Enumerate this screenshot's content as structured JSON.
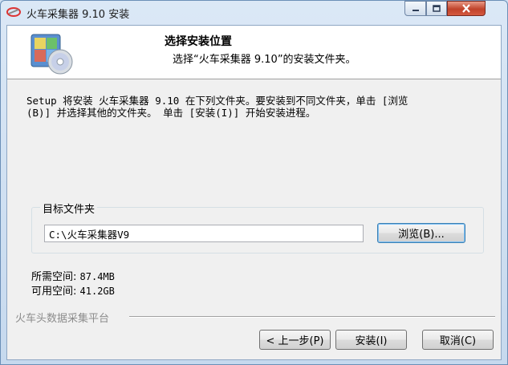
{
  "window": {
    "title": "火车采集器 9.10 安装"
  },
  "header": {
    "title": "选择安装位置",
    "subtitle": "选择“火车采集器 9.10”的安装文件夹。"
  },
  "description": {
    "line1": "Setup 将安装 火车采集器 9.10 在下列文件夹。要安装到不同文件夹，单击 [浏览",
    "line2": "(B)] 并选择其他的文件夹。 单击 [安装(I)] 开始安装进程。"
  },
  "destination": {
    "group_label": "目标文件夹",
    "path": "C:\\火车采集器V9",
    "browse_label": "浏览(B)..."
  },
  "space": {
    "required_label": "所需空间:",
    "required_value": "87.4MB",
    "available_label": "可用空间:",
    "available_value": "41.2GB"
  },
  "footer": {
    "brand": "火车头数据采集平台",
    "back_label": "< 上一步(P)",
    "install_label": "安装(I)",
    "cancel_label": "取消(C)"
  },
  "icons": {
    "app": "app-logo-icon",
    "header": "install-disc-icon",
    "minimize": "minimize-icon",
    "maximize": "maximize-icon",
    "close": "close-icon"
  },
  "colors": {
    "titlebar": "#cfe0f2",
    "close_button": "#c0432b",
    "focus_border": "#3c7fb1"
  }
}
